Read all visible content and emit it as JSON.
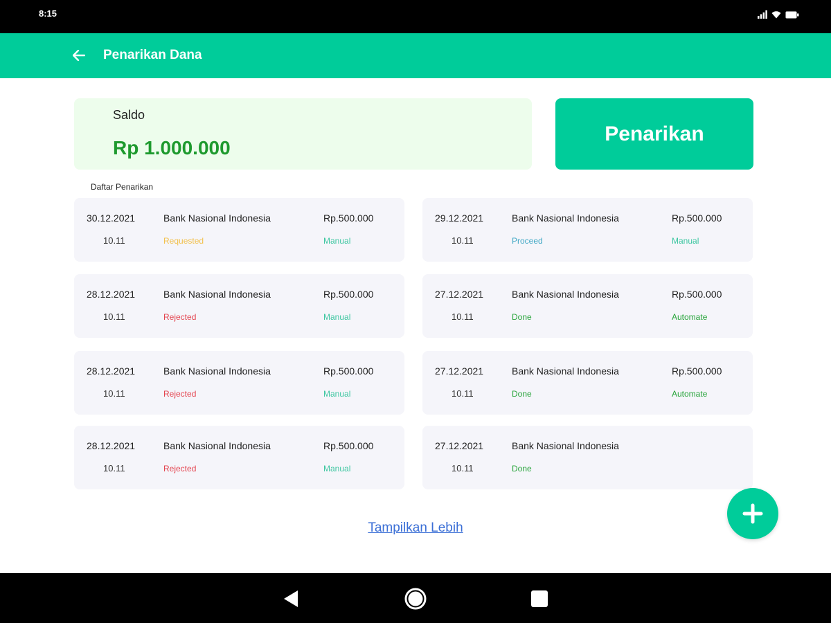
{
  "status_bar": {
    "time": "8:15"
  },
  "app_bar": {
    "title": "Penarikan Dana",
    "back_icon": "arrow-left-icon"
  },
  "balance": {
    "label": "Saldo",
    "value": "Rp 1.000.000"
  },
  "withdraw_button": {
    "label": "Penarikan"
  },
  "list": {
    "title": "Daftar Penarikan",
    "items": [
      {
        "date": "30.12.2021",
        "time": "10.11",
        "bank": "Bank Nasional Indonesia",
        "status": "Requested",
        "status_color": "#F2C14E",
        "amount": "Rp.500.000",
        "method": "Manual",
        "method_color": "#3CC6A0"
      },
      {
        "date": "29.12.2021",
        "time": "10.11",
        "bank": "Bank Nasional Indonesia",
        "status": "Proceed",
        "status_color": "#3FA7C4",
        "amount": "Rp.500.000",
        "method": "Manual",
        "method_color": "#3CC6A0"
      },
      {
        "date": "28.12.2021",
        "time": "10.11",
        "bank": "Bank Nasional Indonesia",
        "status": "Rejected",
        "status_color": "#E4444F",
        "amount": "Rp.500.000",
        "method": "Manual",
        "method_color": "#3CC6A0"
      },
      {
        "date": "27.12.2021",
        "time": "10.11",
        "bank": "Bank Nasional Indonesia",
        "status": "Done",
        "status_color": "#27A43A",
        "amount": "Rp.500.000",
        "method": "Automate",
        "method_color": "#27A43A"
      },
      {
        "date": "28.12.2021",
        "time": "10.11",
        "bank": "Bank Nasional Indonesia",
        "status": "Rejected",
        "status_color": "#E4444F",
        "amount": "Rp.500.000",
        "method": "Manual",
        "method_color": "#3CC6A0"
      },
      {
        "date": "27.12.2021",
        "time": "10.11",
        "bank": "Bank Nasional Indonesia",
        "status": "Done",
        "status_color": "#27A43A",
        "amount": "Rp.500.000",
        "method": "Automate",
        "method_color": "#27A43A"
      },
      {
        "date": "28.12.2021",
        "time": "10.11",
        "bank": "Bank Nasional Indonesia",
        "status": "Rejected",
        "status_color": "#E4444F",
        "amount": "Rp.500.000",
        "method": "Manual",
        "method_color": "#3CC6A0"
      },
      {
        "date": "27.12.2021",
        "time": "10.11",
        "bank": "Bank Nasional Indonesia",
        "status": "Done",
        "status_color": "#27A43A",
        "amount": "",
        "method": "",
        "method_color": "#27A43A"
      }
    ]
  },
  "show_more": {
    "label": "Tampilkan Lebih"
  },
  "fab": {
    "icon": "plus-icon"
  },
  "nav_bar": {
    "back_icon": "triangle-back-icon",
    "home_icon": "circle-home-icon",
    "recents_icon": "square-recents-icon"
  },
  "colors": {
    "primary": "#00CC9A",
    "balance_bg": "#EDFDEC",
    "balance_text": "#1E9A2E",
    "card_bg": "#F5F5FA",
    "link": "#3B6FD6"
  }
}
